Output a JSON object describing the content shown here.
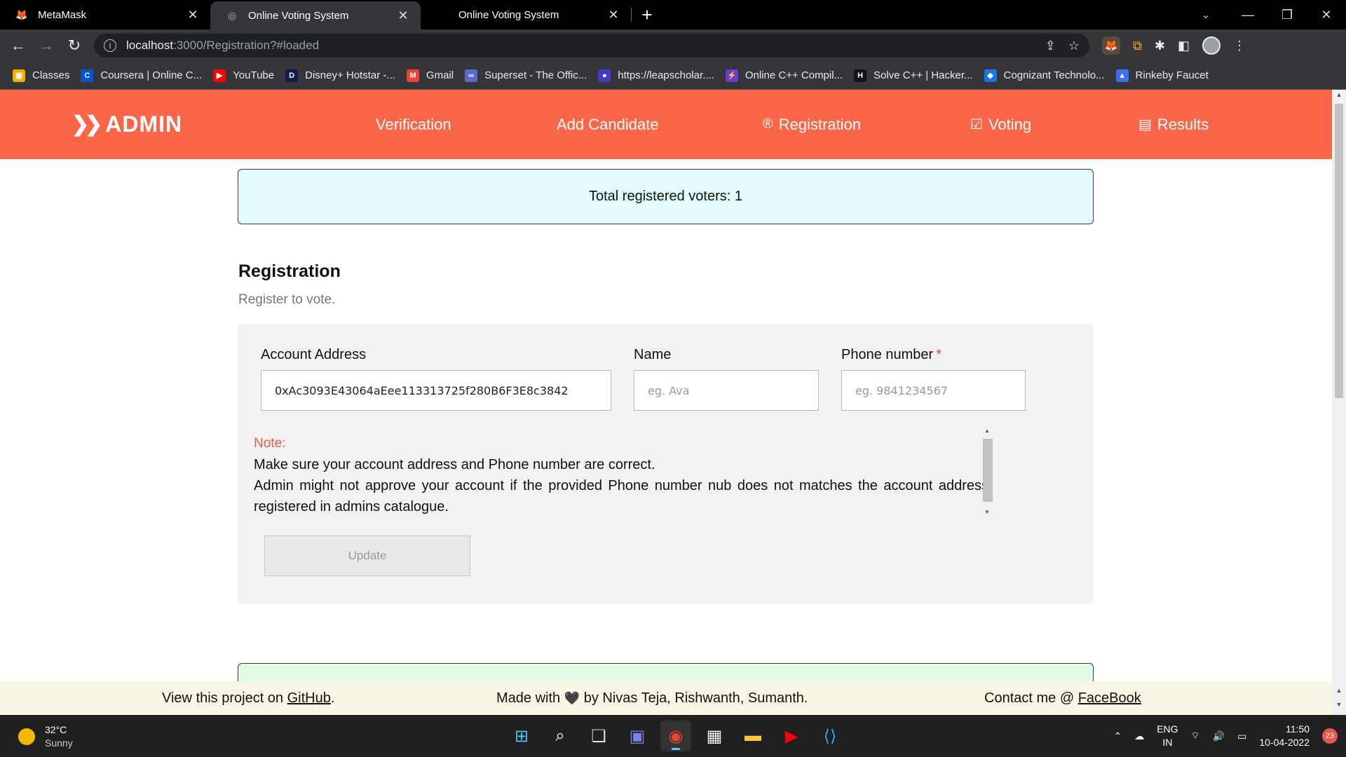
{
  "browser": {
    "tabs": [
      {
        "title": "MetaMask",
        "icon": "metamask-fox-icon",
        "active": false
      },
      {
        "title": "Online Voting System",
        "icon": "globe-icon",
        "active": true
      },
      {
        "title": "Online Voting System",
        "icon": "globe-icon",
        "active": false
      }
    ],
    "url_host": "localhost",
    "url_path": ":3000/Registration?#loaded",
    "bookmarks": [
      {
        "label": "Classes",
        "color": "#f9ab00",
        "glyph": "▣"
      },
      {
        "label": "Coursera | Online C...",
        "color": "#0056d2",
        "glyph": "C"
      },
      {
        "label": "YouTube",
        "color": "#ff0000",
        "glyph": "▶"
      },
      {
        "label": "Disney+ Hotstar -...",
        "color": "#0f1c4d",
        "glyph": "D"
      },
      {
        "label": "Gmail",
        "color": "#ea4335",
        "glyph": "M"
      },
      {
        "label": "Superset - The Offic...",
        "color": "#5a6cc9",
        "glyph": "∞"
      },
      {
        "label": "https://leapscholar....",
        "color": "#443dc4",
        "glyph": "●"
      },
      {
        "label": "Online C++ Compil...",
        "color": "#6c3bd1",
        "glyph": "⚡"
      },
      {
        "label": "Solve C++ | Hacker...",
        "color": "#0e141e",
        "glyph": "H"
      },
      {
        "label": "Cognizant Technolo...",
        "color": "#1a73e8",
        "glyph": "◆"
      },
      {
        "label": "Rinkeby Faucet",
        "color": "#3c6ff5",
        "glyph": "▲"
      }
    ]
  },
  "navbar": {
    "brand": "ADMIN",
    "links": [
      {
        "label": "Verification",
        "icon": ""
      },
      {
        "label": "Add Candidate",
        "icon": ""
      },
      {
        "label": "Registration",
        "icon": "®"
      },
      {
        "label": "Voting",
        "icon": "☑"
      },
      {
        "label": "Results",
        "icon": "▤"
      }
    ]
  },
  "main": {
    "total_voters_text": "Total registered voters: 1",
    "section_title": "Registration",
    "section_subtitle": "Register to vote.",
    "form": {
      "account_label": "Account Address",
      "account_value": "0xAc3093E43064aEee113313725f280B6F3E8c3842",
      "name_label": "Name",
      "name_placeholder": "eg. Ava",
      "phone_label": "Phone number",
      "phone_required_mark": "*",
      "phone_placeholder": "eg. 9841234567"
    },
    "note_label": "Note:",
    "note_line1": "Make sure your account address and Phone number are correct.",
    "note_line2": "Admin might not approve your account if the provided Phone number nub does not matches the account address registered in admins catalogue.",
    "update_button": "Update"
  },
  "footer": {
    "github_prefix": "View this project on ",
    "github_link": "GitHub",
    "github_suffix": ".",
    "made_prefix": "Made with",
    "made_suffix": "by Nivas Teja, Rishwanth, Sumanth.",
    "contact_prefix": "Contact me @ ",
    "contact_link": "FaceBook"
  },
  "taskbar": {
    "temperature": "32°C",
    "weather": "Sunny",
    "lang_top": "ENG",
    "lang_bottom": "IN",
    "time": "11:50",
    "date": "10-04-2022",
    "notifications": "23"
  },
  "colors": {
    "navbar": "#fb6548",
    "count_box": "#e3fbfb",
    "note_label": "#e8584a"
  }
}
